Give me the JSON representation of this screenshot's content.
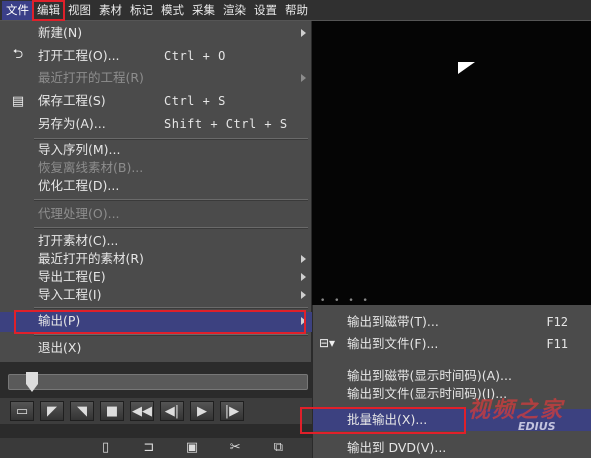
{
  "menubar": {
    "items": [
      "文件",
      "编辑",
      "视图",
      "素材",
      "标记",
      "模式",
      "采集",
      "渲染",
      "设置",
      "帮助"
    ]
  },
  "file_menu": {
    "items": [
      {
        "label": "新建(N)",
        "shortcut": "",
        "submenu": true,
        "disabled": false,
        "icon": ""
      },
      {
        "label": "打开工程(O)...",
        "shortcut": "Ctrl + O",
        "submenu": false,
        "disabled": false,
        "icon": "open-project-icon"
      },
      {
        "label": "最近打开的工程(R)",
        "shortcut": "",
        "submenu": true,
        "disabled": true,
        "icon": ""
      },
      {
        "label": "保存工程(S)",
        "shortcut": "Ctrl + S",
        "submenu": false,
        "disabled": false,
        "icon": "save-icon"
      },
      {
        "label": "另存为(A)...",
        "shortcut": "Shift + Ctrl + S",
        "submenu": false,
        "disabled": false,
        "icon": ""
      },
      {
        "label": "导入序列(M)...",
        "shortcut": "",
        "submenu": false,
        "disabled": false,
        "icon": ""
      },
      {
        "label": "恢复离线素材(B)...",
        "shortcut": "",
        "submenu": false,
        "disabled": true,
        "icon": ""
      },
      {
        "label": "优化工程(D)...",
        "shortcut": "",
        "submenu": false,
        "disabled": false,
        "icon": ""
      },
      {
        "label": "代理处理(O)...",
        "shortcut": "",
        "submenu": false,
        "disabled": true,
        "icon": ""
      },
      {
        "label": "打开素材(C)...",
        "shortcut": "",
        "submenu": false,
        "disabled": false,
        "icon": ""
      },
      {
        "label": "最近打开的素材(R)",
        "shortcut": "",
        "submenu": true,
        "disabled": false,
        "icon": ""
      },
      {
        "label": "导出工程(E)",
        "shortcut": "",
        "submenu": true,
        "disabled": false,
        "icon": ""
      },
      {
        "label": "导入工程(I)",
        "shortcut": "",
        "submenu": true,
        "disabled": false,
        "icon": ""
      },
      {
        "label": "输出(P)",
        "shortcut": "",
        "submenu": true,
        "disabled": false,
        "icon": ""
      },
      {
        "label": "退出(X)",
        "shortcut": "",
        "submenu": false,
        "disabled": false,
        "icon": ""
      }
    ]
  },
  "output_submenu": {
    "items": [
      {
        "label": "输出到磁带(T)...",
        "shortcut": "F12",
        "icon": ""
      },
      {
        "label": "输出到文件(F)...",
        "shortcut": "F11",
        "icon": "export-file-icon"
      },
      {
        "label": "输出到磁带(显示时间码)(A)...",
        "shortcut": "",
        "icon": ""
      },
      {
        "label": "输出到文件(显示时间码)(I)...",
        "shortcut": "",
        "icon": ""
      },
      {
        "label": "批量输出(X)...",
        "shortcut": "",
        "icon": ""
      },
      {
        "label": "输出到 DVD(V)...",
        "shortcut": "",
        "icon": ""
      }
    ]
  },
  "watermark": {
    "main": "视频之家",
    "sub": "EDIUS"
  },
  "colors": {
    "highlight": "#3c4180",
    "annotation_box": "#e0202a",
    "menu_bg": "#4b4b4b"
  }
}
